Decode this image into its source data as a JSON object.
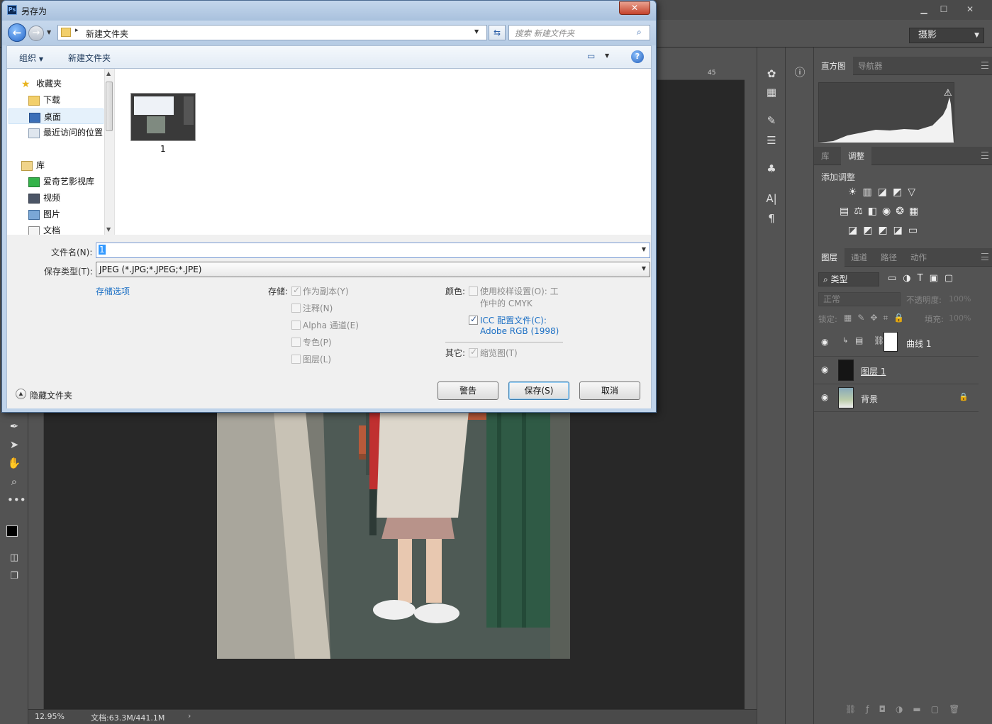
{
  "dialog": {
    "title": "另存为",
    "address_path": "新建文件夹",
    "search_placeholder": "搜索 新建文件夹",
    "organize_label": "组织",
    "new_folder_label": "新建文件夹",
    "nav": {
      "favorites": "收藏夹",
      "downloads": "下载",
      "desktop": "桌面",
      "recent": "最近访问的位置",
      "libraries": "库",
      "iqiyi": "爱奇艺影视库",
      "videos": "视频",
      "pictures": "图片",
      "documents": "文档"
    },
    "file_item": {
      "name": "1"
    },
    "filename_label": "文件名(N):",
    "filename_value": "1",
    "filetype_label": "保存类型(T):",
    "filetype_value": "JPEG (*.JPG;*.JPEG;*.JPE)",
    "save_options_link": "存储选项",
    "storage_label": "存储:",
    "storage_options": {
      "as_copy": "作为副本(Y)",
      "notes": "注释(N)",
      "alpha": "Alpha 通道(E)",
      "spot": "专色(P)",
      "layers": "图层(L)"
    },
    "color_label": "颜色:",
    "use_proof_line1": "使用校样设置(O):  工",
    "use_proof_line2": "作中的 CMYK",
    "icc_line1": "ICC 配置文件(C):",
    "icc_line2": "Adobe RGB (1998)",
    "other_label": "其它:",
    "thumbnail_label": "缩览图(T)",
    "hide_folders": "隐藏文件夹",
    "buttons": {
      "warning": "警告",
      "save": "保存(S)",
      "cancel": "取消"
    }
  },
  "photoshop": {
    "workspace": "摄影",
    "ruler_mark": "45",
    "zoom": "12.95%",
    "doc_info": "文档:63.3M/441.1M",
    "panels": {
      "histogram_tab": "直方图",
      "navigator_tab": "导航器",
      "library_tab": "库",
      "adjustments_tab": "调整",
      "add_adjustment": "添加调整",
      "layers_tab": "图层",
      "channels_tab": "通道",
      "paths_tab": "路径",
      "actions_tab": "动作",
      "filter_kind": "类型",
      "blend_mode": "正常",
      "opacity_label": "不透明度:",
      "opacity_value": "100%",
      "lock_label": "锁定:",
      "fill_label": "填充:",
      "fill_value": "100%"
    },
    "layers": [
      {
        "name": "曲线 1"
      },
      {
        "name": "图层 1"
      },
      {
        "name": "背景"
      }
    ]
  }
}
